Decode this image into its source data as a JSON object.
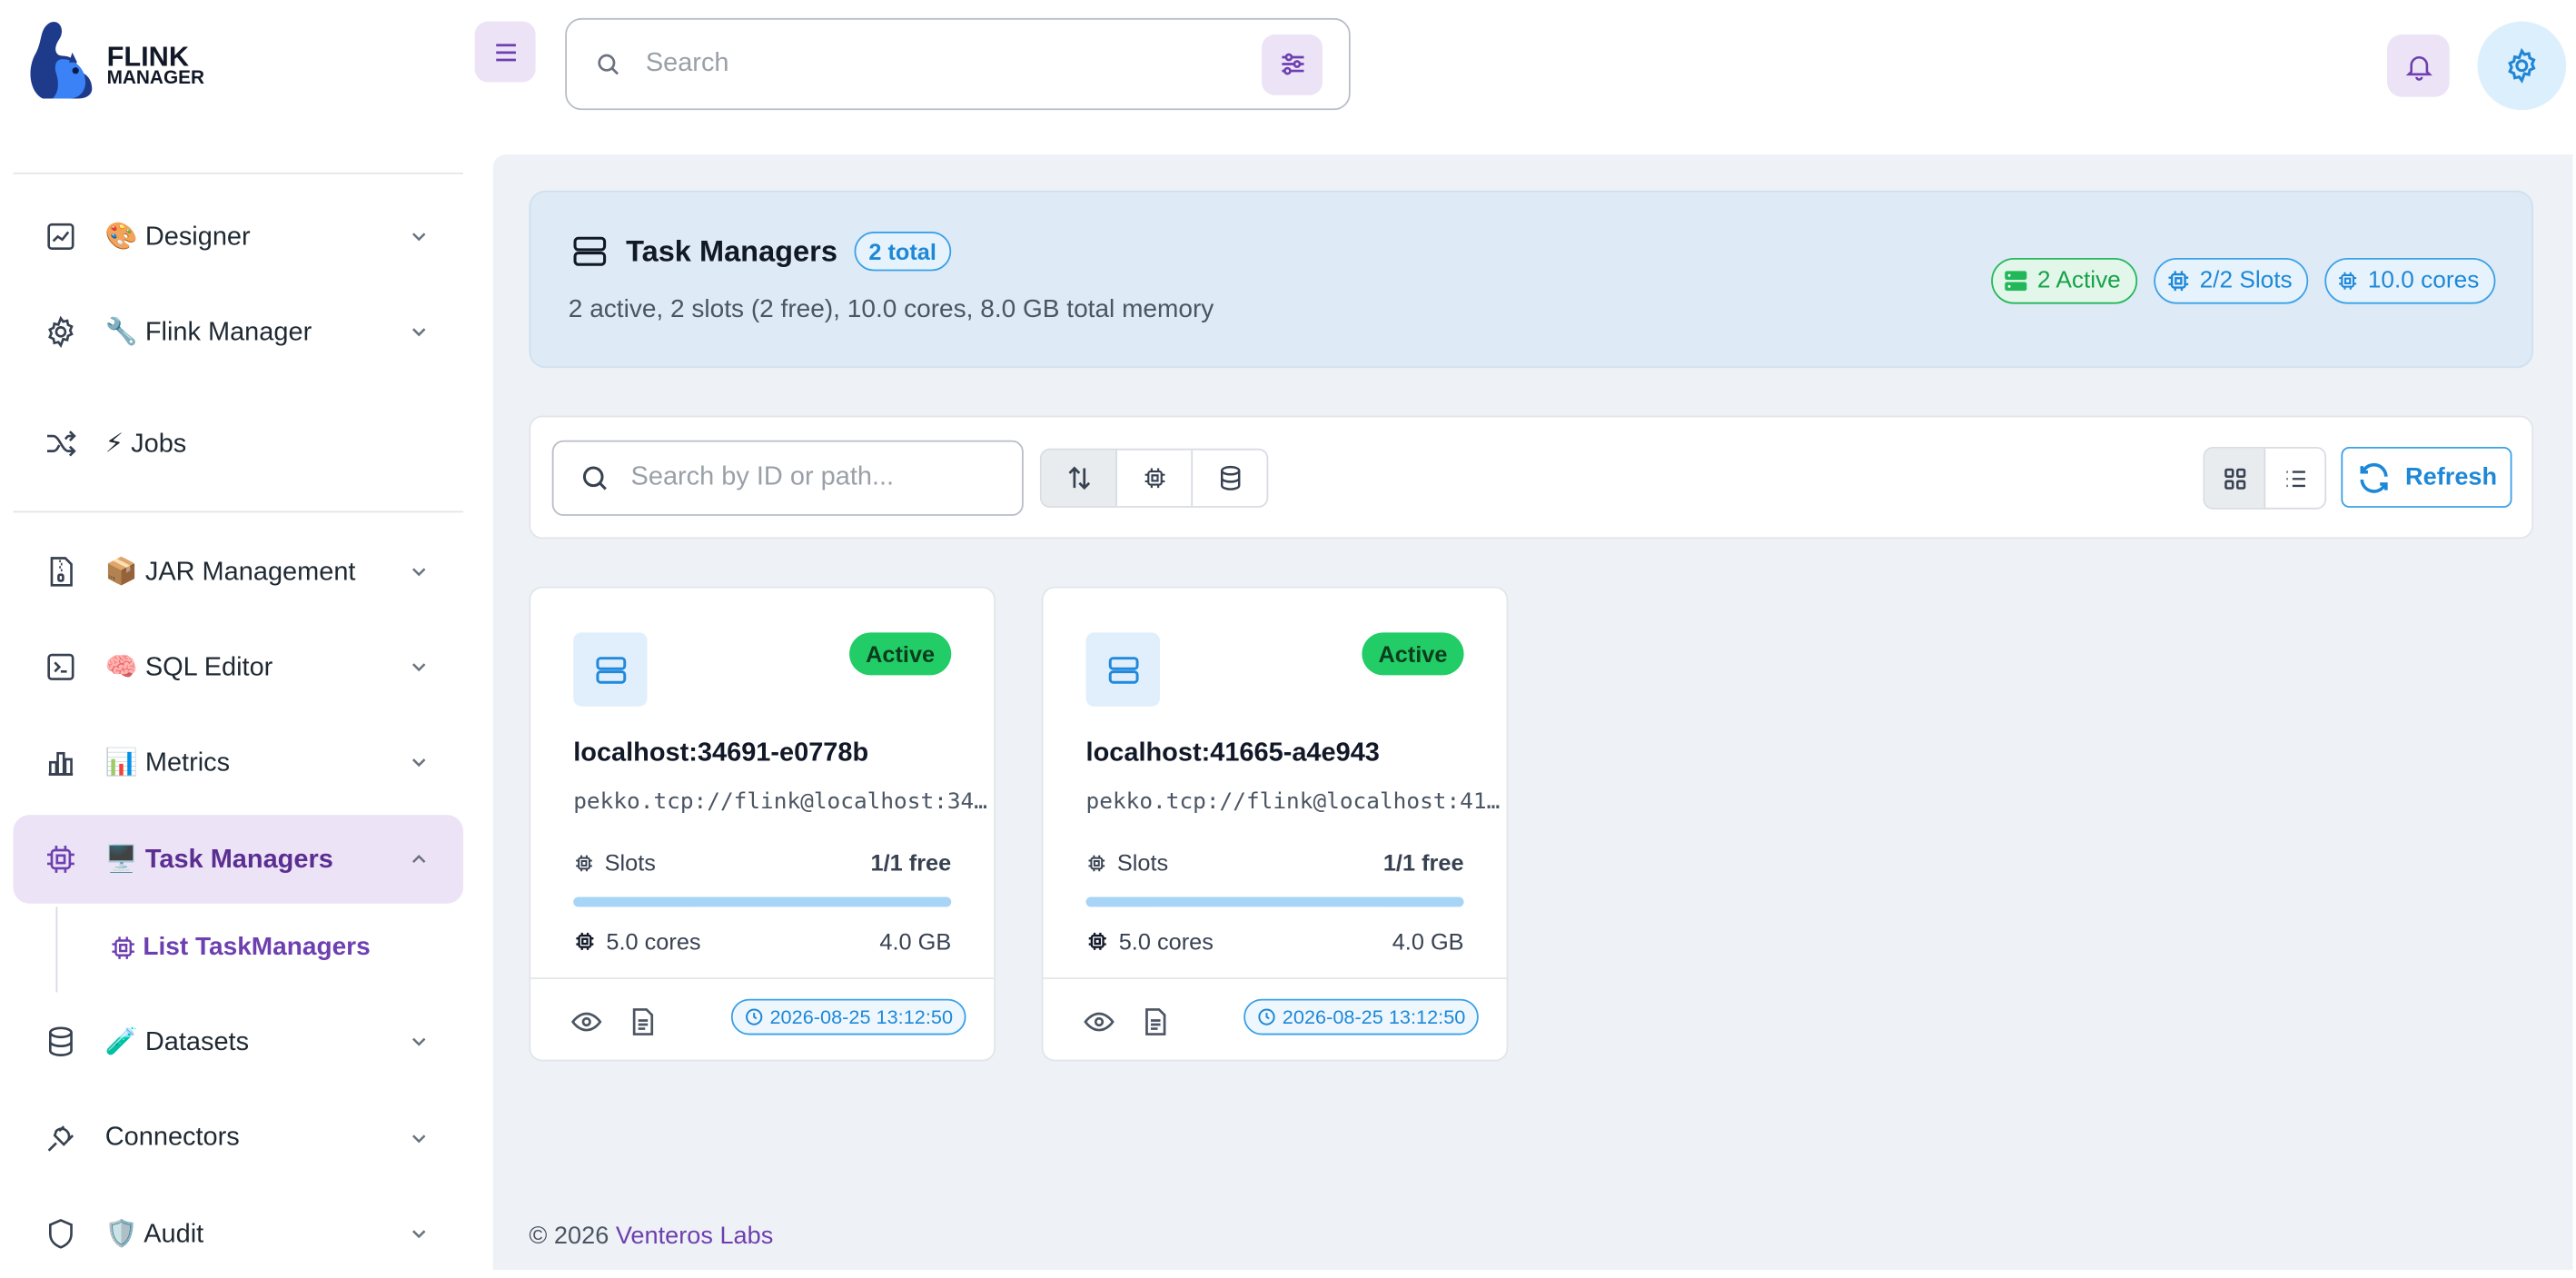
{
  "app": {
    "logo_line1": "FLINK",
    "logo_line2": "MANAGER"
  },
  "header": {
    "search_placeholder": "Search"
  },
  "sidebar": {
    "items": [
      {
        "emoji": "🎨",
        "label": "Designer",
        "icon": "chart-icon"
      },
      {
        "emoji": "🔧",
        "label": "Flink Manager",
        "icon": "gear-icon"
      },
      {
        "emoji": "⚡",
        "label": "Jobs",
        "icon": "shuffle-icon"
      },
      {
        "emoji": "📦",
        "label": "JAR Management",
        "icon": "file-archive-icon"
      },
      {
        "emoji": "🧠",
        "label": "SQL Editor",
        "icon": "terminal-icon"
      },
      {
        "emoji": "📊",
        "label": "Metrics",
        "icon": "bar-chart-icon"
      },
      {
        "emoji": "🖥️",
        "label": "Task Managers",
        "icon": "cpu-icon"
      },
      {
        "emoji": "🧪",
        "label": "Datasets",
        "icon": "database-icon"
      },
      {
        "emoji": "",
        "label": "Connectors",
        "icon": "plug-icon"
      },
      {
        "emoji": "🛡️",
        "label": "Audit",
        "icon": "shield-icon"
      }
    ],
    "sub_item": "List TaskManagers"
  },
  "summary": {
    "title": "Task Managers",
    "count_badge": "2 total",
    "subtitle": "2 active, 2 slots (2 free), 10.0 cores, 8.0 GB total memory",
    "pills": [
      "2 Active",
      "2/2 Slots",
      "10.0 cores"
    ]
  },
  "toolbar": {
    "search_placeholder": "Search by ID or path...",
    "refresh_label": "Refresh"
  },
  "cards": [
    {
      "status": "Active",
      "host": "localhost:34691-e0778b",
      "path": "pekko.tcp://flink@localhost:34..",
      "slots_label": "Slots",
      "slots_value": "1/1 free",
      "slots_fill": 1.0,
      "cores": "5.0 cores",
      "memory": "4.0 GB",
      "timestamp": "2026-08-25 13:12:50"
    },
    {
      "status": "Active",
      "host": "localhost:41665-a4e943",
      "path": "pekko.tcp://flink@localhost:41..",
      "slots_label": "Slots",
      "slots_value": "1/1 free",
      "slots_fill": 1.0,
      "cores": "5.0 cores",
      "memory": "4.0 GB",
      "timestamp": "2026-08-25 13:12:50"
    }
  ],
  "footer": {
    "copyright": "© 2026",
    "brand": "Venteros Labs"
  },
  "colors": {
    "accent": "#6d3fb0",
    "blue": "#1e88d8",
    "green": "#22cc66",
    "main_bg": "#eef2f6"
  }
}
